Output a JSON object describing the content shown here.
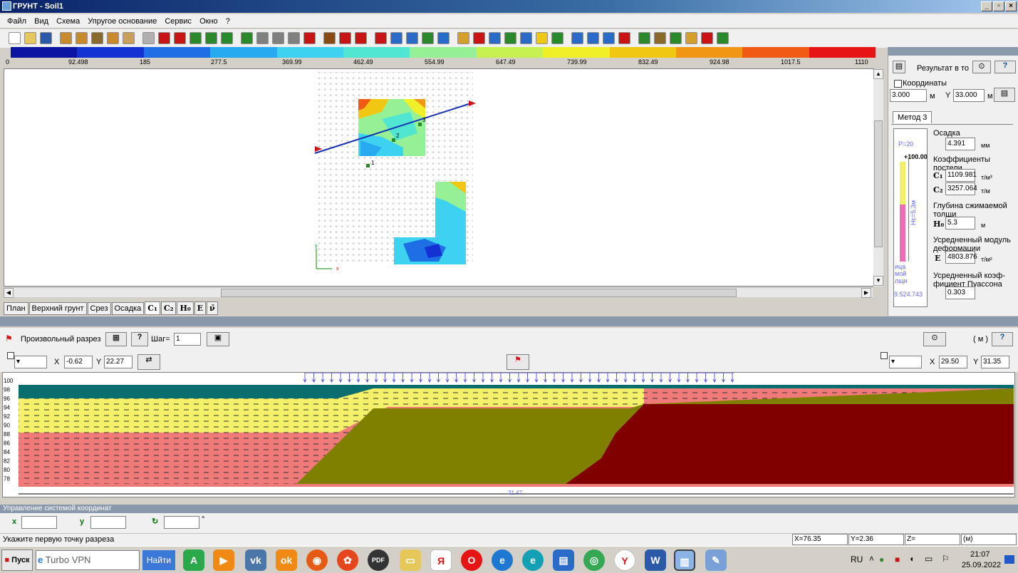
{
  "window": {
    "title": "ГРУНТ - Soil1",
    "min": "_",
    "restore": "▫",
    "close": "×"
  },
  "menu": [
    "Файл",
    "Вид",
    "Схема",
    "Упругое основание",
    "Сервис",
    "Окно",
    "?"
  ],
  "colorscale": {
    "colors": [
      "#0a14a0",
      "#1432d2",
      "#1e6ee6",
      "#28aaf0",
      "#3cd2f0",
      "#50e6d2",
      "#96f096",
      "#c8f050",
      "#f0f028",
      "#f0c814",
      "#f09614",
      "#f05a14",
      "#e61414"
    ],
    "ticks": [
      "0",
      "92.498",
      "185",
      "277.5",
      "369.99",
      "462.49",
      "554.99",
      "647.49",
      "739.99",
      "832.49",
      "924.98",
      "1017.5",
      "1110"
    ]
  },
  "plan": {
    "axis_y": "y",
    "axis_x": "x",
    "point_labels": [
      "1",
      "2",
      "3"
    ]
  },
  "tabs": [
    "План",
    "Верхний грунт",
    "Срез",
    "Осадка",
    "C₁",
    "C₂",
    "H₀",
    "E",
    "ν̄"
  ],
  "rightpanel": {
    "result_label": "Результат в то",
    "help": "?",
    "coords_label": "Координаты",
    "x_value": "3.000",
    "x_unit": "м",
    "y_label": "Y",
    "y_value": "33.000",
    "y_unit": "м",
    "method_tab": "Метод 3",
    "settlement_label": "Осадка",
    "settlement_value": "4.391",
    "settlement_unit": "мм",
    "coeff_label": "Коэффициенты постели",
    "c1_label": "C₁",
    "c1_value": "1109.981",
    "c1_unit": "т/м³",
    "c2_label": "C₂",
    "c2_value": "3257.064",
    "c2_unit": "т/м",
    "depth_label": "Глубина сжимаемой толщи",
    "h0_label": "H₀",
    "h0_value": "5.3",
    "h0_unit": "м",
    "modulus_label": "Усредненный модуль деформации",
    "e_label": "E",
    "e_value": "4803.876",
    "e_unit": "т/м²",
    "poisson_label": "Усредненный коэф-фициент Пуассона",
    "poisson_value": "0.303",
    "column_p": "P=20",
    "column_top": "+100.00",
    "column_hc": "Hc=5.3м",
    "column_side": "ица мой лщи",
    "column_bottom": "9.524.743"
  },
  "section": {
    "title": "Произвольный разрез",
    "step_label": "Шаг=",
    "step_value": "1",
    "unit_label": "( м )",
    "help": "?",
    "x1_label": "X",
    "x1_value": "-0.62",
    "y1_label": "Y",
    "y1_value": "22.27",
    "x2_label": "X",
    "x2_value": "29.50",
    "y2_label": "Y",
    "y2_value": "31.35",
    "depth_ticks": [
      "100",
      "98",
      "96",
      "94",
      "92",
      "90",
      "88",
      "86",
      "84",
      "82",
      "80",
      "78"
    ],
    "bottom_label": "31.47"
  },
  "coordsys": {
    "title": "Управление системой координат",
    "degree": "°"
  },
  "status": {
    "message": "Укажите первую точку разреза",
    "x": "X=76.35",
    "y": "Y=2.36",
    "z": "Z=",
    "unit": "(м)"
  },
  "taskbar": {
    "start": "Пуск",
    "browser": "Turbo VPN",
    "find": "Найти",
    "lang": "RU",
    "time": "21:07",
    "date": "25.09.2022"
  }
}
